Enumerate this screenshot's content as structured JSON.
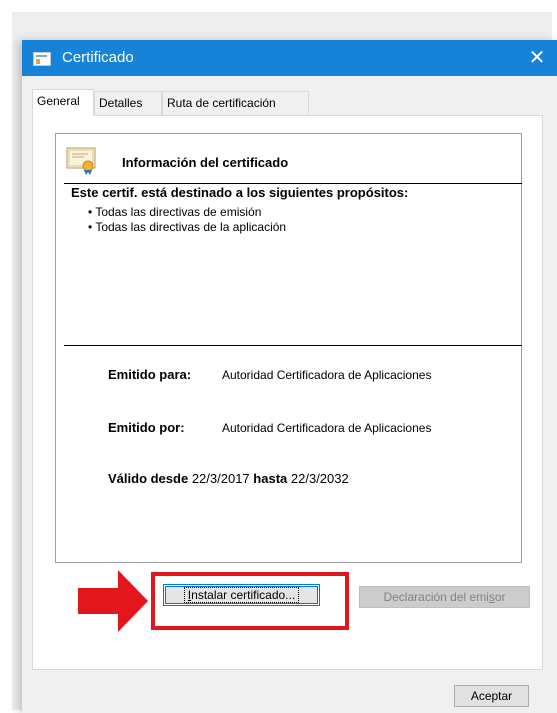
{
  "window": {
    "title": "Certificado",
    "close_glyph": "✕"
  },
  "tabs": [
    {
      "label": "General",
      "active": true
    },
    {
      "label": "Detalles",
      "active": false
    },
    {
      "label": "Ruta de certificación",
      "active": false
    }
  ],
  "cert": {
    "icon": "certificate-icon",
    "heading": "Información del certificado",
    "purpose_title": "Este certif. está destinado a los siguientes propósitos:",
    "purposes": [
      "Todas las directivas de emisión",
      "Todas las directivas de la aplicación"
    ],
    "issued_to_label": "Emitido para:",
    "issued_to_value": "Autoridad Certificadora de Aplicaciones",
    "issued_by_label": "Emitido por:",
    "issued_by_value": "Autoridad Certificadora de Aplicaciones",
    "valid_from_label": "Válido desde",
    "valid_from_value": "22/3/2017",
    "valid_to_label": "hasta",
    "valid_to_value": "22/3/2032"
  },
  "buttons": {
    "install_prefix": "I",
    "install_rest": "nstalar certificado...",
    "emisor_prefix": "Declaración del emi",
    "emisor_u": "s",
    "emisor_rest": "or",
    "accept": "Aceptar"
  },
  "annotation": {
    "arrow_color": "#e3151d",
    "highlight_color": "#e3151d"
  },
  "colors": {
    "titlebar": "#1683d8",
    "accent": "#0078d7"
  }
}
